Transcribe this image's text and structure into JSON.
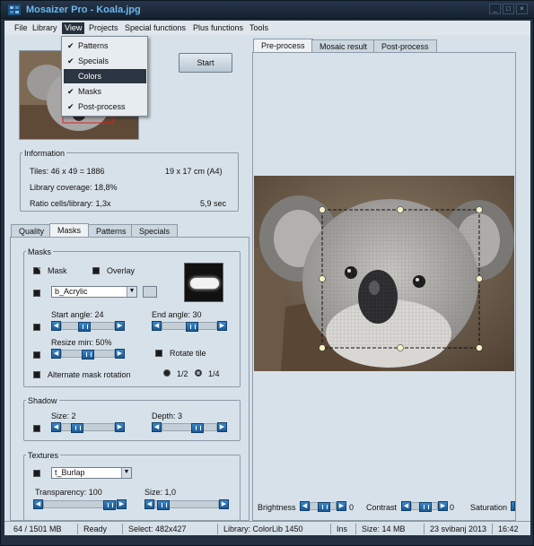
{
  "window": {
    "title": "Mosaizer Pro - Koala.jpg"
  },
  "menu": [
    "File",
    "Library",
    "View",
    "Projects",
    "Special functions",
    "Plus functions",
    "Tools"
  ],
  "view_menu": [
    {
      "label": "Patterns",
      "checked": true
    },
    {
      "label": "Specials",
      "checked": true
    },
    {
      "label": "Colors",
      "checked": false
    },
    {
      "label": "Masks",
      "checked": true
    },
    {
      "label": "Post-process",
      "checked": true
    }
  ],
  "start_label": "Start",
  "info": {
    "title": "Information",
    "tiles": "Tiles: 46 x 49 = 1886",
    "size": "19 x 17 cm  (A4)",
    "coverage": "Library coverage: 18,8%",
    "ratio": "Ratio cells/library: 1,3x",
    "time": "5,9 sec"
  },
  "left_tabs": [
    "Quality",
    "Masks",
    "Patterns",
    "Specials"
  ],
  "masks": {
    "title": "Masks",
    "mask_label": "Mask",
    "overlay_label": "Overlay",
    "mask_combo": "b_Acrylic",
    "start_angle": "Start angle: 24",
    "end_angle": "End angle: 30",
    "resize_min": "Resize min: 50%",
    "rotate_tile": "Rotate tile",
    "alternate": "Alternate mask rotation",
    "half": "1/2",
    "quarter": "1/4"
  },
  "shadow": {
    "title": "Shadow",
    "size": "Size: 2",
    "depth": "Depth: 3"
  },
  "textures": {
    "title": "Textures",
    "combo": "t_Burlap",
    "transparency": "Transparency: 100",
    "size": "Size: 1,0"
  },
  "right_tabs": [
    "Pre-process",
    "Mosaic result",
    "Post-process"
  ],
  "adjust": {
    "brightness": "Brightness",
    "brightness_val": "0",
    "contrast": "Contrast",
    "contrast_val": "0",
    "saturation": "Saturation"
  },
  "status": [
    "64 / 1501 MB",
    "Ready",
    "Select: 482x427",
    "Library: ColorLib 1450",
    "Ins",
    "Size:  14 MB",
    "23 svibanj 2013",
    "16:42"
  ]
}
